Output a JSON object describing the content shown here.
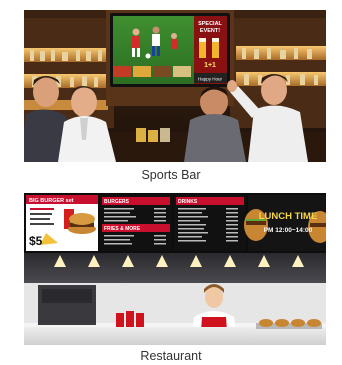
{
  "items": [
    {
      "caption": "Sports Bar",
      "screen": {
        "badge_line1": "SPECIAL",
        "badge_line2": "EVENT!",
        "promo": "1+1",
        "footer": "Happy Hour"
      }
    },
    {
      "caption": "Restaurant",
      "menu_board": {
        "panel1_title": "BIG BURGER set",
        "panel1_price": "$5",
        "panel2_title": "BURGERS",
        "panel2_subtitle": "FRIES & MORE",
        "panel3_title": "DRINKS",
        "panel4_title": "LUNCH TIME",
        "panel4_hours": "PM 12:00~14:00"
      }
    }
  ]
}
